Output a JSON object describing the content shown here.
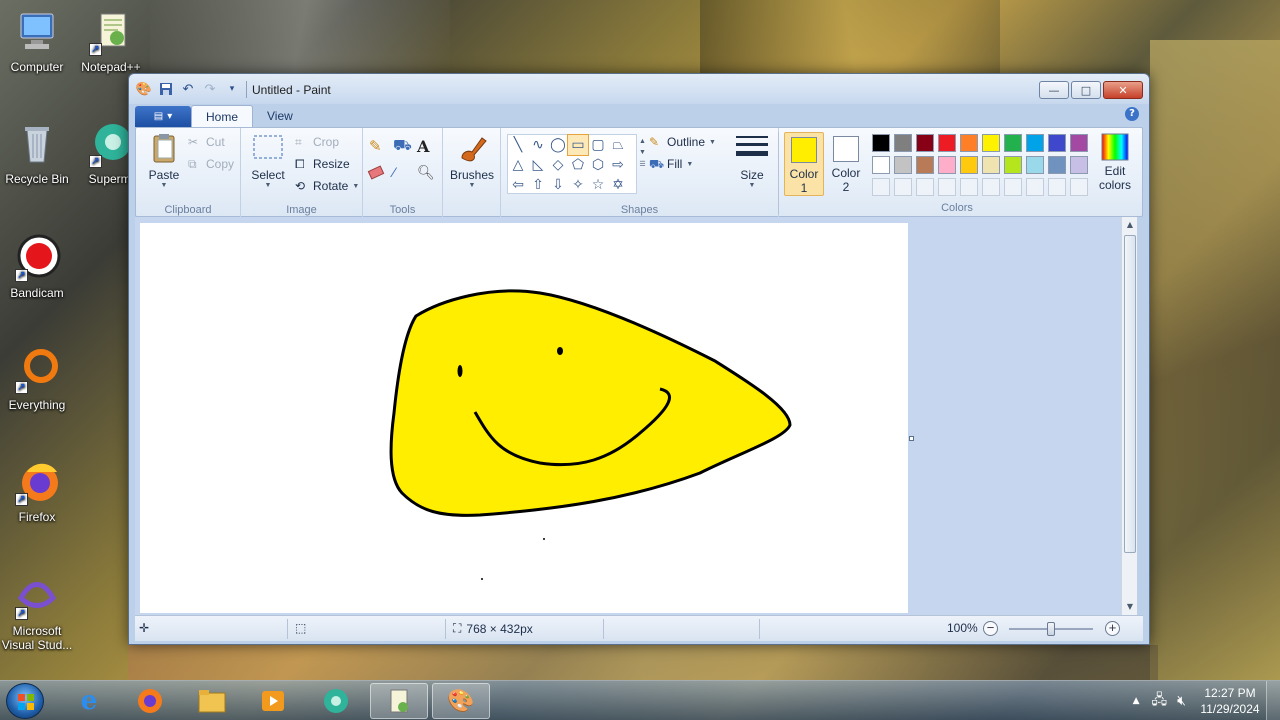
{
  "desktop": {
    "icons": [
      {
        "label": "Computer"
      },
      {
        "label": "Notepad++"
      },
      {
        "label": "Recycle Bin"
      },
      {
        "label": "Supermi"
      },
      {
        "label": "Bandicam"
      },
      {
        "label": "Everything"
      },
      {
        "label": "Firefox"
      },
      {
        "label": "Microsoft Visual Stud..."
      }
    ]
  },
  "window": {
    "title": "Untitled - Paint",
    "controls": {
      "minimize": "—",
      "maximize": "□",
      "close": "✕"
    }
  },
  "ribbon": {
    "tabs": [
      {
        "label": "Home"
      },
      {
        "label": "View"
      }
    ],
    "clipboard": {
      "label": "Clipboard",
      "paste": "Paste",
      "cut": "Cut",
      "copy": "Copy"
    },
    "image": {
      "label": "Image",
      "select": "Select",
      "crop": "Crop",
      "resize": "Resize",
      "rotate": "Rotate"
    },
    "tools": {
      "label": "Tools"
    },
    "brushes": {
      "label": "Brushes"
    },
    "shapes": {
      "label": "Shapes",
      "outline": "Outline",
      "fill": "Fill"
    },
    "size": {
      "label": "Size"
    },
    "colors": {
      "label": "Colors",
      "color1": "Color 1",
      "color1_line1": "Color",
      "color1_line2": "1",
      "color2_line1": "Color",
      "color2_line2": "2",
      "color1_value": "#ffee00",
      "color2_value": "#ffffff",
      "edit_line1": "Edit",
      "edit_line2": "colors",
      "palette_row1": [
        "#000000",
        "#7f7f7f",
        "#880015",
        "#ed1c24",
        "#ff7f27",
        "#fff200",
        "#22b14c",
        "#00a2e8",
        "#3f48cc",
        "#a349a4"
      ],
      "palette_row2": [
        "#ffffff",
        "#c3c3c3",
        "#b97a57",
        "#ffaec9",
        "#ffc90e",
        "#efe4b0",
        "#b5e61d",
        "#99d9ea",
        "#7092be",
        "#c8bfe7"
      ]
    }
  },
  "status": {
    "canvas_size": "768 × 432px",
    "zoom": "100%"
  },
  "taskbar": {
    "clock_time": "12:27 PM",
    "clock_date": "11/29/2024"
  },
  "colors": {
    "drawing_fill": "#ffee00",
    "drawing_stroke": "#000000"
  }
}
